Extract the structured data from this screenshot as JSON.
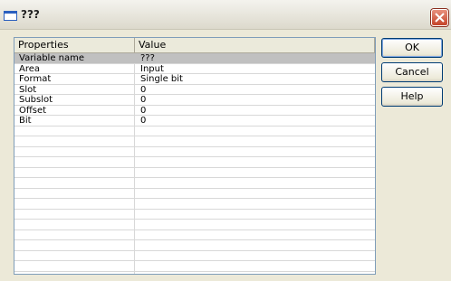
{
  "window": {
    "title": "???"
  },
  "table": {
    "headers": [
      "Properties",
      "Value"
    ],
    "rows": [
      {
        "property": "Variable name",
        "value": "???"
      },
      {
        "property": "Area",
        "value": "Input"
      },
      {
        "property": "Format",
        "value": "Single bit"
      },
      {
        "property": "Slot",
        "value": "0"
      },
      {
        "property": "Subslot",
        "value": "0"
      },
      {
        "property": "Offset",
        "value": "0"
      },
      {
        "property": "Bit",
        "value": "0"
      }
    ],
    "selected_row": 0
  },
  "buttons": {
    "ok": "OK",
    "cancel": "Cancel",
    "help": "Help"
  }
}
